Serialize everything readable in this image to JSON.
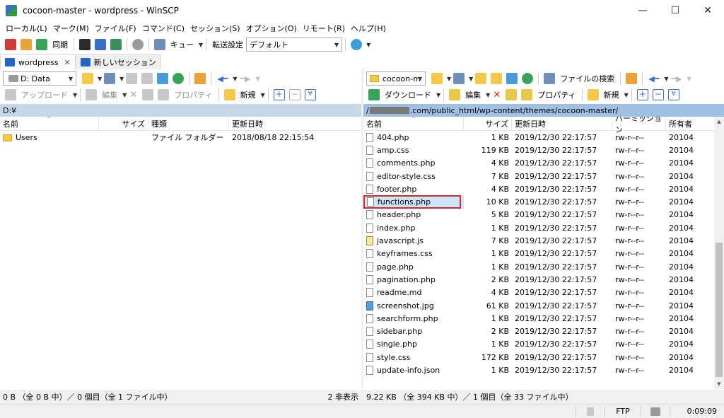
{
  "window": {
    "title": "cocoon-master - wordpress - WinSCP",
    "minimize": "—",
    "maximize": "☐",
    "close": "✕"
  },
  "menu": [
    "ローカル(L)",
    "マーク(M)",
    "ファイル(F)",
    "コマンド(C)",
    "セッション(S)",
    "オプション(O)",
    "リモート(R)",
    "ヘルプ(H)"
  ],
  "toolbar": {
    "sync_label": "同期",
    "queue_label": "キュー",
    "transfer_settings_label": "転送設定",
    "transfer_preset": "デフォルト"
  },
  "tabs": [
    {
      "label": "wordpress",
      "close": "✕"
    },
    {
      "label": "新しいセッション"
    }
  ],
  "left_panel": {
    "drive": "D: Data",
    "upload_label": "アップロード",
    "edit_label": "編集",
    "properties_label": "プロパティ",
    "new_label": "新規",
    "path": "D:¥",
    "columns": [
      "名前",
      "サイズ",
      "種類",
      "更新日時"
    ],
    "rows": [
      {
        "name": "Users",
        "size": "",
        "type": "ファイル フォルダー",
        "modified": "2018/08/18  22:15:54"
      }
    ],
    "status": "0 B （全 0 B 中）／ 0 個目（全 1 ファイル中）",
    "hidden": "2 非表示"
  },
  "right_panel": {
    "folder": "cocoon-m",
    "find_label": "ファイルの検索",
    "download_label": "ダウンロード",
    "edit_label": "編集",
    "properties_label": "プロパティ",
    "new_label": "新規",
    "path_prefix": "/",
    "path_suffix": ".com/public_html/wp-content/themes/cocoon-master/",
    "columns": [
      "名前",
      "サイズ",
      "更新日時",
      "パーミッション",
      "所有者"
    ],
    "rows": [
      {
        "name": "404.php",
        "size": "1 KB",
        "modified": "2019/12/30 22:17:57",
        "perm": "rw-r--r--",
        "owner": "20104",
        "icon": "file"
      },
      {
        "name": "amp.css",
        "size": "119 KB",
        "modified": "2019/12/30 22:17:57",
        "perm": "rw-r--r--",
        "owner": "20104",
        "icon": "file"
      },
      {
        "name": "comments.php",
        "size": "4 KB",
        "modified": "2019/12/30 22:17:57",
        "perm": "rw-r--r--",
        "owner": "20104",
        "icon": "file"
      },
      {
        "name": "editor-style.css",
        "size": "7 KB",
        "modified": "2019/12/30 22:17:57",
        "perm": "rw-r--r--",
        "owner": "20104",
        "icon": "file"
      },
      {
        "name": "footer.php",
        "size": "4 KB",
        "modified": "2019/12/30 22:17:57",
        "perm": "rw-r--r--",
        "owner": "20104",
        "icon": "file"
      },
      {
        "name": "functions.php",
        "size": "10 KB",
        "modified": "2019/12/30 22:17:57",
        "perm": "rw-r--r--",
        "owner": "20104",
        "icon": "file"
      },
      {
        "name": "header.php",
        "size": "5 KB",
        "modified": "2019/12/30 22:17:57",
        "perm": "rw-r--r--",
        "owner": "20104",
        "icon": "file"
      },
      {
        "name": "index.php",
        "size": "1 KB",
        "modified": "2019/12/30 22:17:57",
        "perm": "rw-r--r--",
        "owner": "20104",
        "icon": "file"
      },
      {
        "name": "javascript.js",
        "size": "7 KB",
        "modified": "2019/12/30 22:17:57",
        "perm": "rw-r--r--",
        "owner": "20104",
        "icon": "js"
      },
      {
        "name": "keyframes.css",
        "size": "1 KB",
        "modified": "2019/12/30 22:17:57",
        "perm": "rw-r--r--",
        "owner": "20104",
        "icon": "file"
      },
      {
        "name": "page.php",
        "size": "1 KB",
        "modified": "2019/12/30 22:17:57",
        "perm": "rw-r--r--",
        "owner": "20104",
        "icon": "file"
      },
      {
        "name": "pagination.php",
        "size": "2 KB",
        "modified": "2019/12/30 22:17:57",
        "perm": "rw-r--r--",
        "owner": "20104",
        "icon": "file"
      },
      {
        "name": "readme.md",
        "size": "4 KB",
        "modified": "2019/12/30 22:17:57",
        "perm": "rw-r--r--",
        "owner": "20104",
        "icon": "file"
      },
      {
        "name": "screenshot.jpg",
        "size": "61 KB",
        "modified": "2019/12/30 22:17:57",
        "perm": "rw-r--r--",
        "owner": "20104",
        "icon": "jpg"
      },
      {
        "name": "searchform.php",
        "size": "1 KB",
        "modified": "2019/12/30 22:17:57",
        "perm": "rw-r--r--",
        "owner": "20104",
        "icon": "file"
      },
      {
        "name": "sidebar.php",
        "size": "2 KB",
        "modified": "2019/12/30 22:17:57",
        "perm": "rw-r--r--",
        "owner": "20104",
        "icon": "file"
      },
      {
        "name": "single.php",
        "size": "1 KB",
        "modified": "2019/12/30 22:17:57",
        "perm": "rw-r--r--",
        "owner": "20104",
        "icon": "file"
      },
      {
        "name": "style.css",
        "size": "172 KB",
        "modified": "2019/12/30 22:17:57",
        "perm": "rw-r--r--",
        "owner": "20104",
        "icon": "file"
      },
      {
        "name": "update-info.json",
        "size": "1 KB",
        "modified": "2019/12/30 22:17:57",
        "perm": "rw-r--r--",
        "owner": "20104",
        "icon": "file"
      }
    ],
    "highlighted_file": "functions.php",
    "status": "9.22 KB （全 394 KB 中）／ 1 個目（全 33 ファイル中）"
  },
  "statusbar": {
    "protocol": "FTP",
    "elapsed": "0:09:09"
  },
  "colors": {
    "path_left_bg": "#c7d7ea",
    "path_right_bg": "#9fbfe3",
    "highlight_border": "#d9262e",
    "selection_bg": "#cce8ff"
  }
}
